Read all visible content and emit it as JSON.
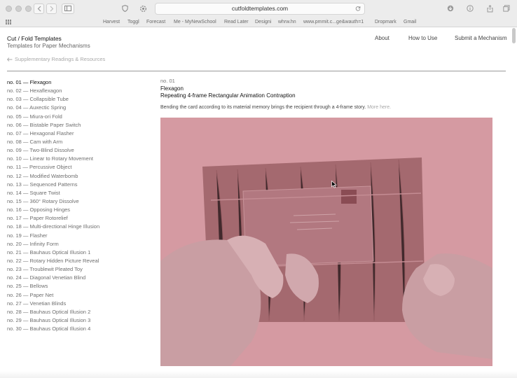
{
  "browser": {
    "url": "cutfoldtemplates.com",
    "bookmarks": [
      "Harvest",
      "Toggl",
      "Forecast",
      "Me - MyNewSchool",
      "Read Later",
      "Designi",
      "whrw.hn",
      "www.pmmit.c...ge&wauth=1",
      "Dropmark",
      "Gmail"
    ]
  },
  "site": {
    "title": "Cut / Fold Templates",
    "subtitle": "Templates for Paper Mechanisms",
    "nav": [
      "About",
      "How to Use",
      "Submit a Mechanism"
    ],
    "back_link": "Supplementary Readings & Resources"
  },
  "mechanisms": [
    "no. 01 — Flexagon",
    "no. 02 — Hexaflexagon",
    "no. 03 — Collapsible Tube",
    "no. 04 — Auxectic Spring",
    "no. 05 — Miura-ori Fold",
    "no. 06 — Bistable Paper Switch",
    "no. 07 — Hexagonal Flasher",
    "no. 08 — Cam with Arm",
    "no. 09 — Two-Blind Dissolve",
    "no. 10 — Linear to Rotary Movement",
    "no. 11 — Percussive Object",
    "no. 12 — Modified Waterbomb",
    "no. 13 — Sequenced Patterns",
    "no. 14 — Square Twist",
    "no. 15 — 360° Rotary Dissolve",
    "no. 16 — Opposing Hinges",
    "no. 17 — Paper Rotorelief",
    "no. 18 — Multi-directional Hinge Illusion",
    "no. 19 — Flasher",
    "no. 20 — Infinity Form",
    "no. 21 — Bauhaus Optical Illusion 1",
    "no. 22 — Rotary Hidden Picture Reveal",
    "no. 23 — Troublewit Pleated Toy",
    "no. 24 — Diagonal Venetian Blind",
    "no. 25 — Bellows",
    "no. 26 — Paper Net",
    "no. 27 — Venetian Blinds",
    "no. 28 — Bauhaus Optical Illusion 2",
    "no. 29 — Bauhaus Optical Illusion 3",
    "no. 30 — Bauhaus Optical Illusion 4"
  ],
  "detail": {
    "number": "no. 01",
    "title": "Flexagon",
    "subtitle": "Repeating 4-frame Rectangular Animation Contraption",
    "description": "Bending the card according to its material memory brings the recipient through a 4-frame story.",
    "more_link": "More here."
  },
  "colors": {
    "video_tint": "#d59aa2",
    "card": "#a4696f",
    "link_muted": "#a8a8a8"
  },
  "icons": {
    "shield": "shield-icon",
    "sidebar": "sidebar-icon",
    "reload": "reload-icon",
    "back_arrow": "arrow-left-icon"
  }
}
